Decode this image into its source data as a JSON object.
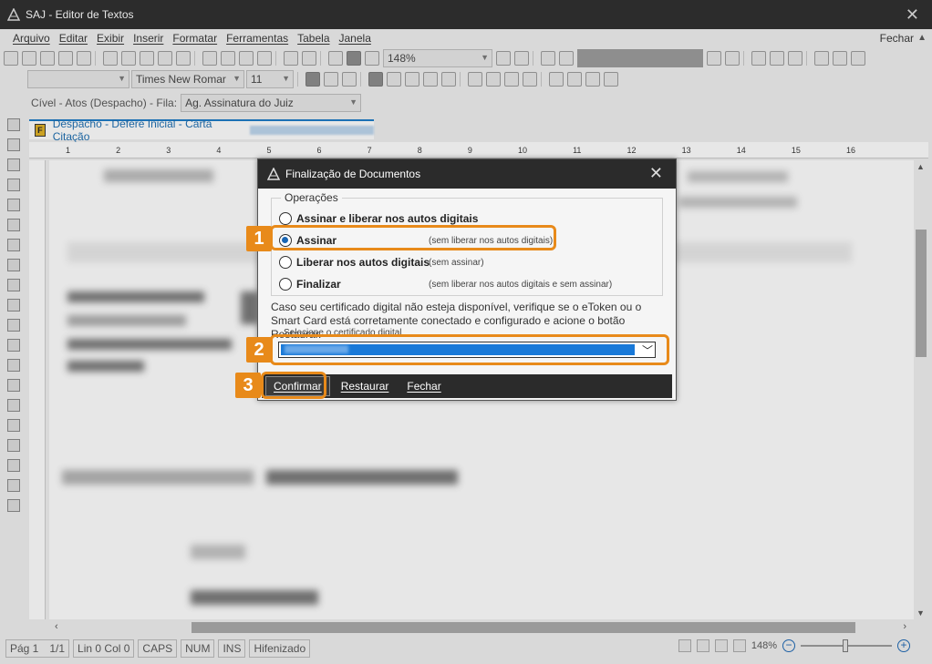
{
  "window": {
    "title": "SAJ - Editor de Textos",
    "close_glyph": "✕"
  },
  "menu": {
    "items": [
      "Arquivo",
      "Editar",
      "Exibir",
      "Inserir",
      "Formatar",
      "Ferramentas",
      "Tabela",
      "Janela"
    ],
    "right_label": "Fechar"
  },
  "toolbar": {
    "zoom": "148%",
    "font_name": "Times New Romar",
    "font_size": "11"
  },
  "fila": {
    "label": "Cível - Atos (Despacho) - Fila:",
    "value": "Ag. Assinatura do Juiz"
  },
  "tab": {
    "label": "Despacho - Defere Inicial - Carta Citação"
  },
  "ruler": {
    "marks": [
      "1",
      "2",
      "3",
      "4",
      "5",
      "6",
      "7",
      "8",
      "9",
      "10",
      "11",
      "12",
      "13",
      "14",
      "15",
      "16"
    ]
  },
  "status": {
    "page": "Pág 1",
    "pages": "1/1",
    "linecol": "Lin 0  Col 0",
    "caps": "CAPS",
    "num": "NUM",
    "ins": "INS",
    "hyph": "Hifenizado",
    "zoom": "148%"
  },
  "dialog": {
    "title": "Finalização de Documentos",
    "group_title": "Operações",
    "options": [
      {
        "label": "Assinar e liberar nos autos digitais",
        "hint": "",
        "selected": false
      },
      {
        "label": "Assinar",
        "hint": "(sem liberar nos autos digitais)",
        "selected": true
      },
      {
        "label": "Liberar nos autos digitais",
        "hint": "(sem assinar)",
        "selected": false
      },
      {
        "label": "Finalizar",
        "hint": "(sem liberar nos autos digitais e sem assinar)",
        "selected": false
      }
    ],
    "info": "Caso seu certificado digital não esteja disponível, verifique se o eToken ou o Smart Card está corretamente conectado e configurado e acione o botão Restaurar.",
    "cert_label": "Selecione o certificado digital",
    "buttons": {
      "confirm": "Confirmar",
      "restore": "Restaurar",
      "close": "Fechar"
    }
  },
  "callouts": [
    "1",
    "2",
    "3"
  ],
  "colors": {
    "accent": "#e88a1a",
    "titlebar": "#2b2b2b",
    "selection": "#1979d8",
    "tab_accent": "#1979c6"
  }
}
